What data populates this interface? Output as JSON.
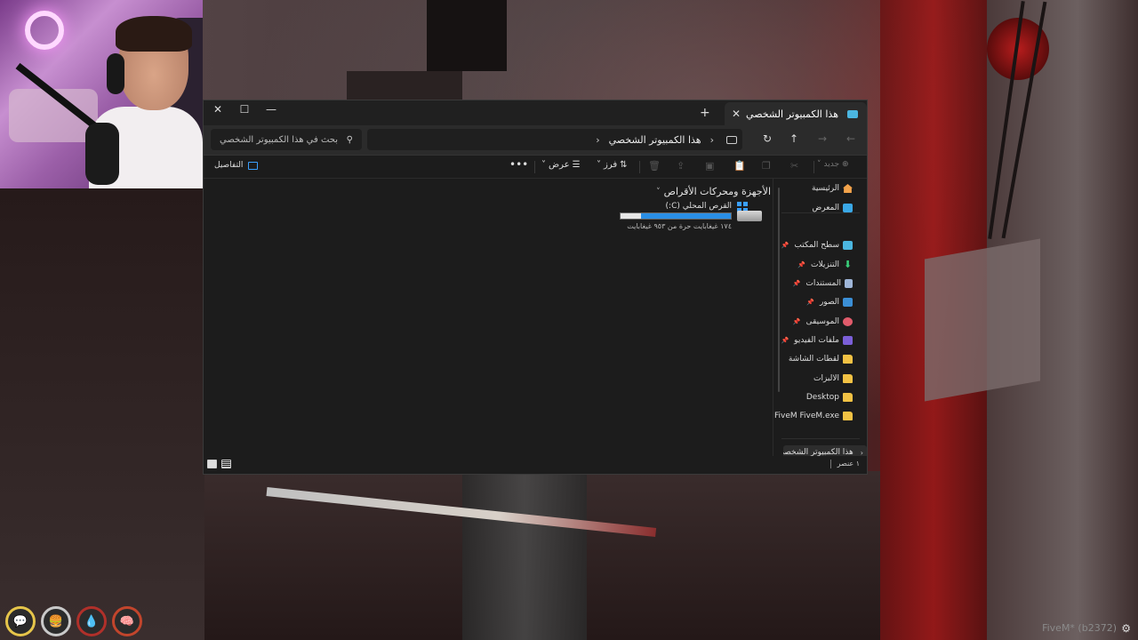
{
  "window": {
    "tab_title": "هذا الكمبيوتر الشخصي",
    "tab_icon": "pc-icon",
    "new_tab": "+",
    "tab_close": "✕",
    "controls": {
      "minimize": "—",
      "maximize": "☐",
      "close": "✕"
    }
  },
  "addressbar": {
    "breadcrumb": [
      "هذا الكمبيوتر الشخصي"
    ],
    "search_placeholder": "بحث في هذا الكمبيوتر الشخصي",
    "nav": {
      "back": "←",
      "forward": "→",
      "up": "↑",
      "refresh": "↻"
    }
  },
  "commandbar": {
    "new_label": "جديد",
    "sort_label": "فرز",
    "view_label": "عرض",
    "more_label": "•••",
    "details_label": "التفاصيل"
  },
  "sidebar": {
    "items": [
      {
        "label": "الرئيسية",
        "icon": "home-icon",
        "pinned": false
      },
      {
        "label": "المعرض",
        "icon": "gallery-icon",
        "pinned": false
      },
      {
        "label": "سطح المكتب",
        "icon": "desktop-icon",
        "pinned": true
      },
      {
        "label": "التنزيلات",
        "icon": "downloads-icon",
        "pinned": true
      },
      {
        "label": "المستندات",
        "icon": "documents-icon",
        "pinned": true
      },
      {
        "label": "الصور",
        "icon": "pictures-icon",
        "pinned": true
      },
      {
        "label": "الموسيقى",
        "icon": "music-icon",
        "pinned": true
      },
      {
        "label": "ملفات الفيديو",
        "icon": "videos-icon",
        "pinned": true
      },
      {
        "label": "لقطات الشاشة",
        "icon": "folder-icon",
        "pinned": false
      },
      {
        "label": "الالبزات",
        "icon": "folder-icon",
        "pinned": false
      },
      {
        "label": "Desktop",
        "icon": "folder-icon",
        "pinned": false
      },
      {
        "label": "FiveM FiveM.exe",
        "icon": "folder-icon",
        "pinned": false
      }
    ],
    "this_pc": "هذا الكمبيوتر الشخصي"
  },
  "content": {
    "section_title": "الأجهزة ومحركات الأقراص",
    "drive": {
      "name": "القرص المحلي (C:)",
      "space_text": "١٧٤ غيغابايت حرة من ٩٥٣ غيغابايت",
      "used_fraction": 0.817
    }
  },
  "statusbar": {
    "item_count": "١ عنصر"
  },
  "hud": {
    "icons": [
      "voice-icon",
      "hunger-icon",
      "thirst-icon",
      "stress-icon"
    ]
  },
  "overlay": {
    "fivem_label": "FiveM* (b2372)"
  },
  "colors": {
    "accent": "#2a8fe6",
    "folder": "#f2c244"
  }
}
